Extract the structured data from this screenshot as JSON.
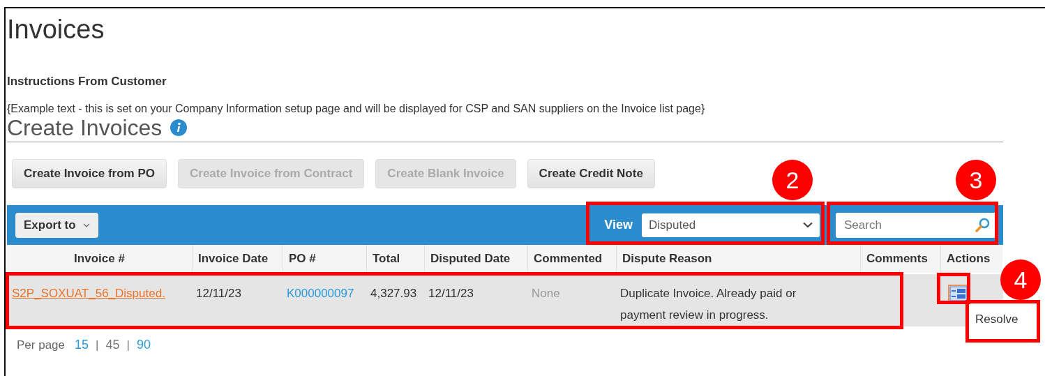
{
  "page_title": "Invoices",
  "instructions": {
    "heading": "Instructions From Customer",
    "text": "{Example text - this is set on your Company Information setup page and will be displayed for CSP and SAN suppliers on the Invoice list page}"
  },
  "section_title": "Create Invoices",
  "buttons": [
    {
      "label": "Create Invoice from PO",
      "disabled": false
    },
    {
      "label": "Create Invoice from Contract",
      "disabled": true
    },
    {
      "label": "Create Blank Invoice",
      "disabled": true
    },
    {
      "label": "Create Credit Note",
      "disabled": false
    }
  ],
  "toolbar": {
    "export": "Export to",
    "view_label": "View",
    "view_value": "Disputed",
    "search": {
      "placeholder": "Search"
    }
  },
  "table": {
    "columns": [
      "Invoice #",
      "Invoice Date",
      "PO #",
      "Total",
      "Disputed Date",
      "Commented",
      "Dispute Reason",
      "Comments",
      "Actions"
    ],
    "rows": [
      {
        "invoice": "S2P_SOXUAT_56_Disputed.",
        "invoice_date": "12/11/23",
        "po": "K000000097",
        "total": "4,327.93",
        "disputed_date": "12/11/23",
        "commented": "None",
        "dispute_reason": "Duplicate Invoice. Already paid or payment review in progress."
      }
    ]
  },
  "action_menu": [
    "Resolve"
  ],
  "per_page": {
    "label": "Per page",
    "separator": "|",
    "options": [
      {
        "label": "15",
        "selected": false
      },
      {
        "label": "45",
        "selected": true
      },
      {
        "label": "90",
        "selected": false
      }
    ]
  },
  "callouts": [
    "2",
    "3",
    "4"
  ]
}
